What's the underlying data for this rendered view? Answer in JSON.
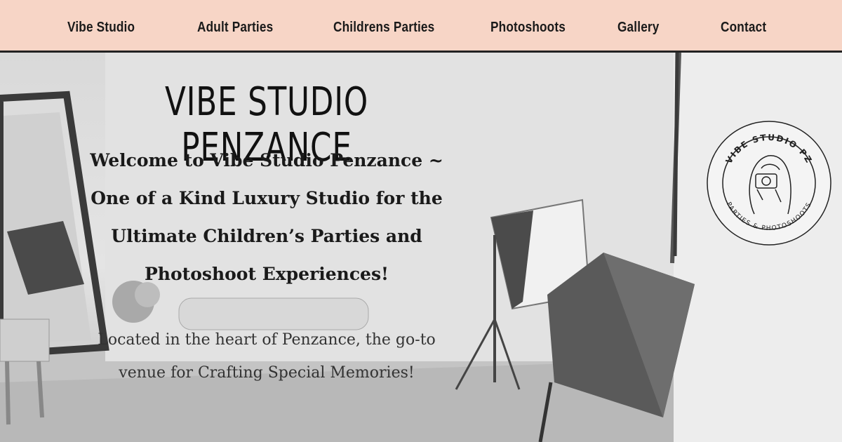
{
  "nav": {
    "items": [
      {
        "label": "Vibe Studio"
      },
      {
        "label": "Adult Parties"
      },
      {
        "label": "Childrens Parties"
      },
      {
        "label": "Photoshoots"
      },
      {
        "label": "Gallery"
      },
      {
        "label": "Contact"
      }
    ]
  },
  "hero": {
    "title": "VIBE STUDIO PENZANCE",
    "headline": "Welcome to Vibe Studio Penzance ~ One of a Kind Luxury Studio for the Ultimate Children’s Parties and Photoshoot Experiences!",
    "subtext": "Located in the heart of Penzance, the go-to venue for Crafting Special Memories!"
  },
  "logo": {
    "top_text": "VIBE STUDIO PZ",
    "bottom_text": "PARTIES & PHOTOSHOOTS",
    "icon": "woman-with-camera-icon"
  },
  "colors": {
    "nav_bg": "#f7d5c6",
    "text": "#1a1a1a"
  }
}
